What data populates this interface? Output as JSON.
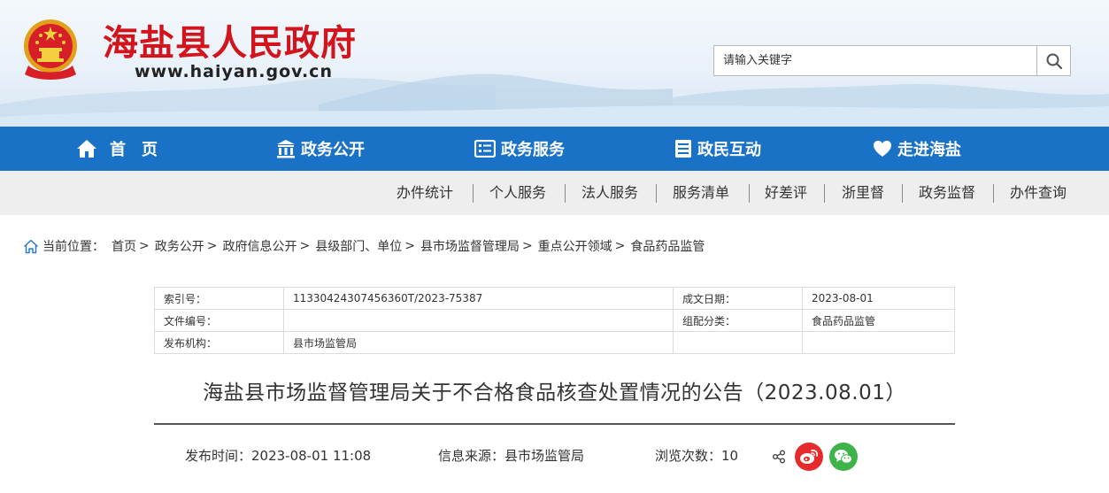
{
  "header": {
    "site_title": "海盐县人民政府",
    "site_url": "www.haiyan.gov.cn",
    "search_placeholder": "请输入关键字",
    "colors": {
      "title": "#d2141c",
      "nav": "#1a72c7",
      "subnav": "#eeeeee"
    }
  },
  "main_nav": [
    {
      "label": "首　页",
      "icon": "home-icon"
    },
    {
      "label": "政务公开",
      "icon": "government-building-icon"
    },
    {
      "label": "政务服务",
      "icon": "service-list-icon"
    },
    {
      "label": "政民互动",
      "icon": "interaction-document-icon"
    },
    {
      "label": "走进海盐",
      "icon": "heart-icon"
    }
  ],
  "sub_nav": [
    "办件统计",
    "个人服务",
    "法人服务",
    "服务清单",
    "好差评",
    "浙里督",
    "政务监督",
    "办件查询"
  ],
  "breadcrumb": {
    "label": "当前位置：",
    "icon": "home-outline-icon",
    "items": [
      "首页",
      "政务公开",
      "政府信息公开",
      "县级部门、单位",
      "县市场监督管理局",
      "重点公开领域",
      "食品药品监管"
    ]
  },
  "meta": {
    "index_label": "索引号：",
    "index_value": "11330424307456360T/2023-75387",
    "date_label": "成文日期：",
    "date_value": "2023-08-01",
    "docno_label": "文件编号：",
    "docno_value": "",
    "category_label": "组配分类：",
    "category_value": "食品药品监管",
    "publisher_label": "发布机构：",
    "publisher_value": "县市场监管局"
  },
  "article": {
    "title": "海盐县市场监督管理局关于不合格食品核查处置情况的公告（2023.08.01）",
    "publish_time": "发布时间：2023-08-01 11:08",
    "source": "信息来源：县市场监管局",
    "views": "浏览次数：10"
  },
  "share": {
    "icons": [
      "share-icon",
      "weibo-icon",
      "wechat-icon"
    ]
  }
}
